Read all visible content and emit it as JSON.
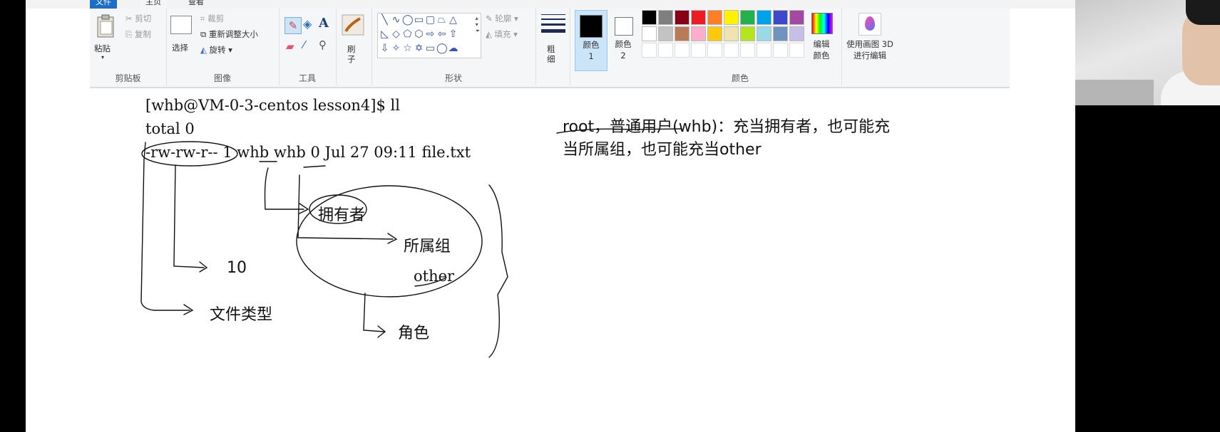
{
  "tabs": [
    "文件",
    "主页",
    "查看"
  ],
  "clipboard": {
    "paste": "粘贴",
    "cut": "剪切",
    "copy": "复制",
    "label": "剪贴板"
  },
  "image": {
    "select": "选择",
    "crop": "裁剪",
    "resize": "重新调整大小",
    "rotate": "旋转",
    "label": "图像"
  },
  "tools": {
    "label": "工具"
  },
  "brush": {
    "label": "刷子"
  },
  "shapes": {
    "outline": "轮廓",
    "fill": "填充",
    "label": "形状"
  },
  "size": {
    "label": "粗细"
  },
  "color1": {
    "label": "颜色 1"
  },
  "color2": {
    "label": "颜色 2"
  },
  "colors": {
    "label": "颜色",
    "edit": "编辑颜色",
    "row1": [
      "#000000",
      "#7f7f7f",
      "#880015",
      "#ed1c24",
      "#ff7f27",
      "#fff200",
      "#22b14c",
      "#00a2e8",
      "#3f48cc",
      "#a349a4"
    ],
    "row2": [
      "#ffffff",
      "#c3c3c3",
      "#b97a57",
      "#ffaec9",
      "#ffc90e",
      "#efe4b0",
      "#b5e61d",
      "#99d9ea",
      "#7092be",
      "#c8bfe7"
    ],
    "row3": [
      "#ffffff",
      "#ffffff",
      "#ffffff",
      "#ffffff",
      "#ffffff",
      "#ffffff",
      "#ffffff",
      "#ffffff",
      "#ffffff",
      "#ffffff"
    ]
  },
  "paint3d": {
    "label": "使用画图 3D 进行编辑"
  },
  "canvas": {
    "line1": "[whb@VM-0-3-centos lesson4]$ ll",
    "line2": "total 0",
    "line3_perm": "-rw-rw-r--",
    "line3_rest": " 1 whb whb 0 Jul 27 09:11 file.txt",
    "note1": "root，普通用户(whb)：充当拥有者，也可能充",
    "note2": "当所属组，也可能充当other",
    "owner": "拥有者",
    "group": "所属组",
    "other": "other",
    "ten": "10",
    "filetype": "文件类型",
    "role": "角色"
  }
}
